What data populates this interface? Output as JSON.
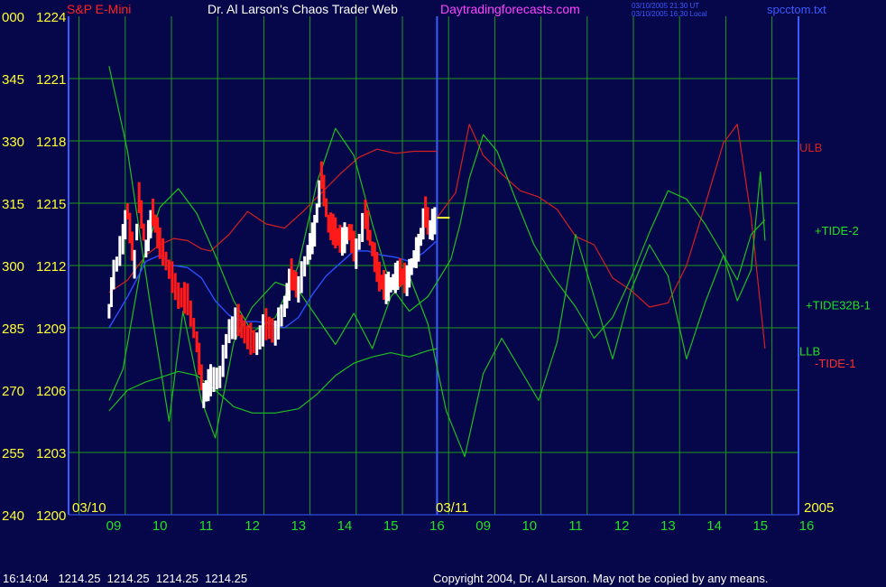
{
  "header": {
    "instrument": "S&P E-Mini",
    "title": "Dr. Al Larson's Chaos Trader Web",
    "site": "Daytradingforecasts.com",
    "stamp_line1": "03/10/2005 21:30 UT",
    "stamp_line2": "03/10/2005 16:30 Local",
    "file": "spcctom.txt"
  },
  "footer": {
    "quote": "16:14:04   1214.25  1214.25  1214.25  1214.25",
    "copyright": "Copyright 2004, Dr. Al Larson. May not be copied by any means."
  },
  "colors": {
    "background": "#06064a",
    "grid": "#1f9a1f",
    "price_up": "#ffffff",
    "price_down": "#ff1a1a",
    "ulb": "#d42020",
    "tide": "#1fbf1f",
    "tide32": "#2e8f2e",
    "moving_avg": "#2a4fff",
    "tick_labels": "#ffff33",
    "date_labels": "#22e022",
    "site_text": "#ff44ff",
    "file_text": "#3a5cff"
  },
  "chart_data": {
    "type": "line",
    "title": "S&P E-Mini",
    "y_left_labels": [
      {
        "angle": "000",
        "price": "1224"
      },
      {
        "angle": "345",
        "price": "1221"
      },
      {
        "angle": "330",
        "price": "1218"
      },
      {
        "angle": "315",
        "price": "1215"
      },
      {
        "angle": "300",
        "price": "1212"
      },
      {
        "angle": "285",
        "price": "1209"
      },
      {
        "angle": "270",
        "price": "1206"
      },
      {
        "angle": "255",
        "price": "1203"
      },
      {
        "angle": "240",
        "price": "1200"
      }
    ],
    "ylim": [
      1200,
      1224
    ],
    "x_hours": [
      "09",
      "10",
      "11",
      "12",
      "13",
      "14",
      "15",
      "16",
      "09",
      "10",
      "11",
      "12",
      "13",
      "14",
      "15",
      "16"
    ],
    "date_markers": [
      "03/10",
      "03/11"
    ],
    "year_label": "2005",
    "last_price": 1214.25,
    "series_labels": [
      {
        "name": "ULB",
        "price": 1217.7,
        "color": "#d42020"
      },
      {
        "name": "+TIDE-2",
        "price": 1213.7,
        "color": "#22e022"
      },
      {
        "name": "+TIDE32B-1",
        "price": 1210.1,
        "color": "#22e022"
      },
      {
        "name": "LLB",
        "price": 1207.9,
        "color": "#22e022"
      },
      {
        "name": "-TIDE-1",
        "price": 1207.3,
        "color": "#ff3030"
      }
    ],
    "price_path": [
      [
        8.9,
        1209.8
      ],
      [
        9.0,
        1211.5
      ],
      [
        9.2,
        1213.2
      ],
      [
        9.3,
        1214.6
      ],
      [
        9.45,
        1212.0
      ],
      [
        9.55,
        1215.2
      ],
      [
        9.7,
        1212.8
      ],
      [
        9.85,
        1214.5
      ],
      [
        10.0,
        1213.0
      ],
      [
        10.2,
        1211.8
      ],
      [
        10.4,
        1210.5
      ],
      [
        10.6,
        1210.3
      ],
      [
        10.8,
        1208.3
      ],
      [
        10.95,
        1205.7
      ],
      [
        11.1,
        1206.4
      ],
      [
        11.3,
        1206.6
      ],
      [
        11.5,
        1208.8
      ],
      [
        11.7,
        1209.3
      ],
      [
        11.9,
        1208.5
      ],
      [
        12.1,
        1208.2
      ],
      [
        12.3,
        1209.1
      ],
      [
        12.5,
        1208.7
      ],
      [
        12.7,
        1210.0
      ],
      [
        12.85,
        1211.5
      ],
      [
        13.0,
        1210.8
      ],
      [
        13.2,
        1212.5
      ],
      [
        13.35,
        1213.6
      ],
      [
        13.5,
        1216.3
      ],
      [
        13.65,
        1214.0
      ],
      [
        13.8,
        1213.5
      ],
      [
        13.95,
        1213.1
      ],
      [
        14.1,
        1213.6
      ],
      [
        14.25,
        1212.5
      ],
      [
        14.45,
        1214.4
      ],
      [
        14.6,
        1212.8
      ],
      [
        14.75,
        1211.4
      ],
      [
        14.9,
        1210.8
      ],
      [
        15.05,
        1211.2
      ],
      [
        15.2,
        1211.6
      ],
      [
        15.35,
        1211.2
      ],
      [
        15.5,
        1212.3
      ],
      [
        15.6,
        1212.8
      ],
      [
        15.75,
        1214.5
      ],
      [
        15.85,
        1213.7
      ],
      [
        16.0,
        1214.3
      ]
    ],
    "ulb_path": [
      [
        8.9,
        1210.7
      ],
      [
        9.3,
        1211.3
      ],
      [
        9.7,
        1212.5
      ],
      [
        10.0,
        1213.0
      ],
      [
        10.3,
        1213.3
      ],
      [
        10.6,
        1213.2
      ],
      [
        10.9,
        1212.8
      ],
      [
        11.1,
        1212.7
      ],
      [
        11.5,
        1213.5
      ],
      [
        11.9,
        1214.6
      ],
      [
        12.3,
        1214.0
      ],
      [
        12.7,
        1213.8
      ],
      [
        13.1,
        1214.6
      ],
      [
        13.5,
        1215.5
      ],
      [
        13.9,
        1216.4
      ],
      [
        14.3,
        1217.2
      ],
      [
        14.7,
        1217.6
      ],
      [
        15.1,
        1217.4
      ],
      [
        15.5,
        1217.5
      ],
      [
        16.0,
        1217.5
      ]
    ],
    "tide_path": [
      [
        8.9,
        1205.5
      ],
      [
        9.2,
        1207.0
      ],
      [
        9.6,
        1212.0
      ],
      [
        10.0,
        1214.8
      ],
      [
        10.4,
        1215.7
      ],
      [
        10.8,
        1214.5
      ],
      [
        11.2,
        1212.5
      ],
      [
        11.6,
        1210.3
      ],
      [
        12.0,
        1208.8
      ],
      [
        12.5,
        1209.5
      ],
      [
        13.0,
        1212.0
      ],
      [
        13.4,
        1216.0
      ],
      [
        13.8,
        1218.6
      ],
      [
        14.2,
        1217.3
      ],
      [
        14.6,
        1214.0
      ],
      [
        15.0,
        1211.0
      ],
      [
        15.4,
        1209.8
      ],
      [
        15.8,
        1210.5
      ],
      [
        16.0,
        1211.2
      ],
      [
        16.3,
        1212.3
      ],
      [
        16.5,
        1214.0
      ],
      [
        16.7,
        1216.2
      ],
      [
        17.0,
        1218.3
      ],
      [
        17.3,
        1217.5
      ],
      [
        17.7,
        1215.2
      ],
      [
        18.1,
        1213.0
      ],
      [
        18.5,
        1211.5
      ],
      [
        19.0,
        1210.0
      ],
      [
        19.4,
        1208.5
      ],
      [
        19.8,
        1209.5
      ],
      [
        20.2,
        1211.4
      ],
      [
        20.6,
        1213.6
      ],
      [
        21.0,
        1215.6
      ],
      [
        21.4,
        1215.2
      ],
      [
        21.8,
        1214.0
      ],
      [
        22.2,
        1212.5
      ],
      [
        22.5,
        1211.3
      ],
      [
        22.8,
        1213.5
      ],
      [
        23.1,
        1214.2
      ]
    ],
    "tide32_path": [
      [
        8.9,
        1221.6
      ],
      [
        9.3,
        1217.5
      ],
      [
        9.8,
        1210.0
      ],
      [
        10.2,
        1204.5
      ],
      [
        10.5,
        1209.8
      ],
      [
        10.9,
        1205.5
      ],
      [
        11.2,
        1203.7
      ],
      [
        11.6,
        1208.3
      ],
      [
        12.0,
        1210.0
      ],
      [
        12.5,
        1211.2
      ],
      [
        13.0,
        1210.8
      ],
      [
        13.4,
        1209.5
      ],
      [
        13.8,
        1208.2
      ],
      [
        14.2,
        1209.7
      ],
      [
        14.6,
        1208.0
      ],
      [
        15.0,
        1210.5
      ],
      [
        15.4,
        1211.5
      ],
      [
        15.8,
        1209.2
      ],
      [
        16.2,
        1205.0
      ],
      [
        16.6,
        1202.8
      ],
      [
        17.0,
        1206.8
      ],
      [
        17.4,
        1208.5
      ],
      [
        17.8,
        1207.0
      ],
      [
        18.2,
        1205.5
      ],
      [
        18.6,
        1208.3
      ],
      [
        19.0,
        1213.5
      ],
      [
        19.4,
        1210.5
      ],
      [
        19.8,
        1207.5
      ],
      [
        20.2,
        1210.8
      ],
      [
        20.6,
        1213.0
      ],
      [
        21.0,
        1211.5
      ],
      [
        21.4,
        1207.5
      ],
      [
        21.8,
        1210.2
      ],
      [
        22.2,
        1212.5
      ],
      [
        22.5,
        1210.3
      ],
      [
        22.8,
        1211.8
      ],
      [
        23.0,
        1216.5
      ],
      [
        23.1,
        1213.2
      ]
    ],
    "llb_path": [
      [
        8.9,
        1205.0
      ],
      [
        9.3,
        1206.0
      ],
      [
        9.7,
        1206.4
      ],
      [
        10.0,
        1206.6
      ],
      [
        10.4,
        1206.9
      ],
      [
        10.8,
        1206.7
      ],
      [
        11.2,
        1206.0
      ],
      [
        11.6,
        1205.2
      ],
      [
        12.0,
        1204.9
      ],
      [
        12.5,
        1204.9
      ],
      [
        13.0,
        1205.1
      ],
      [
        13.4,
        1205.8
      ],
      [
        13.8,
        1206.7
      ],
      [
        14.2,
        1207.3
      ],
      [
        14.6,
        1207.6
      ],
      [
        15.0,
        1207.8
      ],
      [
        15.4,
        1207.6
      ],
      [
        15.8,
        1207.9
      ],
      [
        16.0,
        1208.0
      ]
    ],
    "ma_path": [
      [
        8.9,
        1209.0
      ],
      [
        9.3,
        1210.5
      ],
      [
        9.7,
        1212.2
      ],
      [
        10.0,
        1212.5
      ],
      [
        10.3,
        1212.0
      ],
      [
        10.6,
        1211.9
      ],
      [
        10.9,
        1211.4
      ],
      [
        11.2,
        1210.3
      ],
      [
        11.5,
        1209.6
      ],
      [
        11.8,
        1209.3
      ],
      [
        12.1,
        1209.3
      ],
      [
        12.4,
        1209.2
      ],
      [
        12.7,
        1209.0
      ],
      [
        13.0,
        1209.5
      ],
      [
        13.3,
        1210.6
      ],
      [
        13.6,
        1211.5
      ],
      [
        13.9,
        1212.1
      ],
      [
        14.2,
        1212.7
      ],
      [
        14.5,
        1212.7
      ],
      [
        14.8,
        1212.5
      ],
      [
        15.1,
        1212.4
      ],
      [
        15.4,
        1212.2
      ],
      [
        15.7,
        1212.6
      ],
      [
        16.0,
        1213.2
      ]
    ],
    "forecast_ulb_path": [
      [
        16.0,
        1214.3
      ],
      [
        16.4,
        1215.5
      ],
      [
        16.7,
        1218.8
      ],
      [
        17.0,
        1217.3
      ],
      [
        17.4,
        1216.4
      ],
      [
        17.8,
        1215.6
      ],
      [
        18.2,
        1215.3
      ],
      [
        18.6,
        1214.7
      ],
      [
        19.0,
        1213.4
      ],
      [
        19.4,
        1213.0
      ],
      [
        19.8,
        1211.4
      ],
      [
        20.2,
        1210.8
      ],
      [
        20.6,
        1210.0
      ],
      [
        21.0,
        1210.2
      ],
      [
        21.4,
        1212.0
      ],
      [
        21.8,
        1214.9
      ],
      [
        22.2,
        1217.9
      ],
      [
        22.5,
        1218.8
      ],
      [
        22.8,
        1214.3
      ],
      [
        23.1,
        1208.0
      ]
    ],
    "grid_on": true
  }
}
